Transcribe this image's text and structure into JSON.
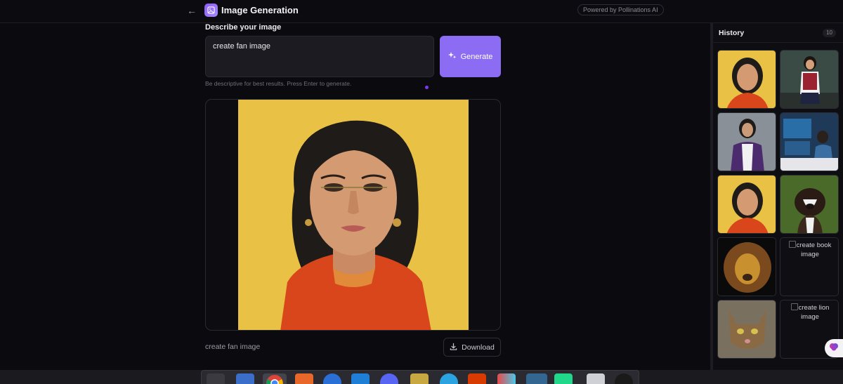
{
  "header": {
    "title": "Image Generation",
    "powered_by": "Powered by Pollinations AI"
  },
  "prompt": {
    "label": "Describe your image",
    "value": "create fan image",
    "hint": "Be descriptive for best results. Press Enter to generate.",
    "generate_label": "Generate"
  },
  "result": {
    "caption": "create fan image",
    "download_label": "Download"
  },
  "history": {
    "title": "History",
    "count": "10",
    "broken_items": [
      "create book image",
      "create lion image"
    ]
  },
  "colors": {
    "accent": "#8b6cf2",
    "background": "#0b0b0f"
  },
  "taskbar": {
    "apps": [
      "terminal-icon",
      "files-icon",
      "chrome-icon",
      "app-store-icon",
      "help-icon",
      "vscode-icon",
      "discord-icon",
      "archive-icon",
      "telegram-icon",
      "office-icon",
      "color-picker-icon",
      "postgres-icon",
      "pycharm-icon",
      "text-editor-icon",
      "system-icon"
    ]
  }
}
